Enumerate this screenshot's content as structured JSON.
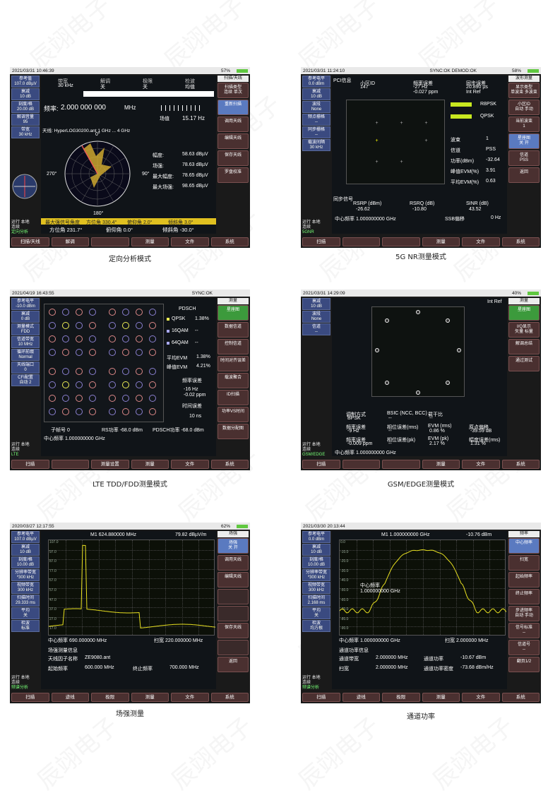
{
  "watermark": "辰翊电子",
  "panels": {
    "p1": {
      "caption": "定向分析模式",
      "datetime": "2021/03/31  10:46:39",
      "battery": "57%",
      "left": [
        {
          "l": "参考值",
          "v": "107.0 dBµV"
        },
        {
          "l": "衰减",
          "v": "10 dB"
        },
        {
          "l": "刻度/格",
          "v": "20.00 dB"
        },
        {
          "l": "解调音量",
          "v": "95"
        },
        {
          "l": "带宽",
          "v": "30 kHz"
        }
      ],
      "right_title": "扫描/天线",
      "right": [
        "扫描类型\n连续  单次",
        "重新扫描",
        "调用天线",
        "编辑天线",
        "保存天线",
        "罗盘校准"
      ],
      "bottom": [
        "扫描/天线",
        "解调",
        "",
        "测量",
        "文件",
        "系统"
      ],
      "headers": [
        "带宽",
        "解调",
        "极限",
        "检波"
      ],
      "header_vals": [
        "30 kHz",
        "关",
        "关",
        "均值"
      ],
      "freq_label": "频率:",
      "freq": "2.000 000 000",
      "freq_unit": "MHz",
      "signal_label": "场值",
      "signal": "15.17 Hz",
      "antenna": "天线: HyperLOG30200.ant  1 GHz ... 4 GHz",
      "deg0": "0°",
      "deg90": "90°",
      "deg180": "180°",
      "deg270": "270°",
      "meas": [
        [
          "幅度:",
          "58.63 dBµV"
        ],
        [
          "场强:",
          "78.63 dBµV"
        ],
        [
          "最大幅度:",
          "78.65 dBµV"
        ],
        [
          "最大场强:",
          "98.65 dBµV"
        ]
      ],
      "yellow": [
        "最大强信号角度",
        "方位角  330.4°",
        "俯仰角  2.0°",
        "倾斜角  3.0°"
      ],
      "azimuth": [
        "方位角  231.7°",
        "俯仰角  0.0°",
        "倾斜角  -30.0°"
      ],
      "status": [
        "运行  本地",
        "连续",
        "定向分析"
      ]
    },
    "p2": {
      "caption": "5G NR测量模式",
      "datetime": "2021/03/31  11:24:10",
      "battery": "58%",
      "sync": "SYNC:OK   DEMOD:OK",
      "left": [
        {
          "l": "参考电平",
          "v": "0.0 dBm"
        },
        {
          "l": "衰减",
          "v": "10 dB"
        },
        {
          "l": "波段",
          "v": "None"
        },
        {
          "l": "频点栅格",
          "v": "--"
        },
        {
          "l": "同步栅格",
          "v": "--"
        },
        {
          "l": "载波间隔",
          "v": "30 kHz"
        }
      ],
      "right_title": "波形测量",
      "right": [
        "显示类型\n单波束 多波束",
        "小区ID\n自动  手动",
        "当前波束\n1",
        "星座图\n关   开",
        "信道\nPSS",
        "返回"
      ],
      "bottom": [
        "扫描",
        "",
        "",
        "测量",
        "文件",
        "系统"
      ],
      "pci_label": "PCI信息",
      "pci_cols": [
        [
          "小区ID",
          "147"
        ],
        [
          "频率误差",
          "-27 Hz",
          "-0.027 ppm"
        ],
        [
          "同步误差",
          "20.890 µs",
          "Int Ref"
        ]
      ],
      "legend": [
        [
          "R8PSK",
          ""
        ],
        [
          "QPSK",
          ""
        ]
      ],
      "info": [
        [
          "波束",
          "1"
        ],
        [
          "信道",
          "PSS"
        ],
        [
          "功率(dBm)",
          "-32.64"
        ],
        [
          "峰值EVM(%)",
          "3.91"
        ],
        [
          "平均EVM(%)",
          "0.63"
        ]
      ],
      "sync_label": "同步信号",
      "rsrp": [
        [
          "RSRP (dBm)",
          "-26.62"
        ],
        [
          "RSRQ (dB)",
          "-10.80"
        ],
        [
          "SINR (dB)",
          "43.52"
        ]
      ],
      "center": "中心频率     1.000000000 GHz",
      "ssb": "SSB偏移",
      "ssb_v": "0 Hz",
      "status": [
        "运行  本地",
        "连续",
        "5GNR"
      ]
    },
    "p3": {
      "caption": "LTE TDD/FDD测量模式",
      "datetime": "2021/04/19  16:43:55",
      "sync": "SYNC:OK",
      "left": [
        {
          "l": "参考电平",
          "v": "-10.0 dBm"
        },
        {
          "l": "衰减",
          "v": "0 dB"
        },
        {
          "l": "测量模式",
          "v": "FDD"
        },
        {
          "l": "信道带宽",
          "v": "10 MHz"
        },
        {
          "l": "循环前缀",
          "v": "Normal"
        },
        {
          "l": "天线端口",
          "v": "0"
        },
        {
          "l": "CFI配置",
          "v": "自动 2"
        }
      ],
      "right_title": "测量",
      "right": [
        "星座图",
        "数据信道",
        "控制信道",
        "时间对齐误差",
        "载波聚合",
        "ID扫描",
        "功率VS时间",
        "数据分配图"
      ],
      "bottom": [
        "扫描",
        "",
        "测量设置",
        "测量",
        "文件",
        "系统"
      ],
      "pdsch": "PDSCH",
      "mods": [
        [
          "QPSK",
          "1.38%"
        ],
        [
          "16QAM",
          "--"
        ],
        [
          "64QAM",
          "--"
        ]
      ],
      "evm": [
        [
          "平均EVM",
          "1.38%"
        ],
        [
          "峰值EVM",
          "4.21%"
        ]
      ],
      "freq_err_label": "频率误差",
      "freq_err": [
        "-16 Hz",
        "-0.02 ppm"
      ],
      "time_err_label": "时间误差",
      "time_err": "10 ns",
      "foot": [
        "子帧号  0",
        "RS功率  -68.0 dBm",
        "PDSCH功率  -68.0 dBm"
      ],
      "center": "中心频率     1.000000000 GHz",
      "status": [
        "运行  本地",
        "连续",
        "LTE"
      ]
    },
    "p4": {
      "caption": "GSM/EDGE测量模式",
      "datetime": "2021/03/31  14:29:09",
      "battery": "40%",
      "intref": "Int Ref",
      "left": [
        {
          "l": "衰减",
          "v": "10 dB"
        },
        {
          "l": "波段",
          "v": "None"
        },
        {
          "l": "信道",
          "v": "--"
        }
      ],
      "right_title": "测量",
      "right": [
        "星座图",
        "I/Q显示\n矢量  标量",
        "解调总结",
        "通过测试"
      ],
      "bottom": [
        "扫描",
        "",
        "",
        "测量",
        "文件",
        "系统"
      ],
      "table": [
        [
          "调制方式",
          "BPSK"
        ],
        [
          "BSIC (NCC, BCC)",
          "--"
        ],
        [
          "载干比",
          "--"
        ]
      ],
      "table2": [
        [
          "频率误差",
          "-9 Hz"
        ],
        [
          "相位误差(rms)",
          "--"
        ],
        [
          "EVM (rms)",
          "0.86 %"
        ],
        [
          "原点偏移",
          "-39.59 dB"
        ]
      ],
      "table3": [
        [
          "频率误差",
          "-0.009 ppm"
        ],
        [
          "相位误差(pk)",
          "--"
        ],
        [
          "EVM (pk)",
          "2.17 %"
        ],
        [
          "幅度误差(rms)",
          "1.31 %"
        ]
      ],
      "center": "中心频率     1.000000000 GHz",
      "status": [
        "运行  本地",
        "连续",
        "GSM/EDGE"
      ]
    },
    "p5": {
      "caption": "场强测量",
      "datetime": "2020/03/27  12:17:55",
      "battery": "62%",
      "marker": "M1    624.880000 MHz",
      "marker_v": "79.82 dBµV/m",
      "left": [
        {
          "l": "参考电平",
          "v": "107.0 dBµV"
        },
        {
          "l": "衰减",
          "v": "10 dB"
        },
        {
          "l": "刻度/格",
          "v": "10.00 dB"
        },
        {
          "l": "分辨率带宽",
          "v": "*300 kHz"
        },
        {
          "l": "视频带宽",
          "v": "300 kHz"
        },
        {
          "l": "扫描时间",
          "v": "29.333 ms"
        },
        {
          "l": "平均",
          "v": "关"
        },
        {
          "l": "检波",
          "v": "标准"
        }
      ],
      "right_title": "场强",
      "right": [
        "场强\n关   开",
        "调用天线",
        "编辑天线",
        "",
        "",
        "保存天线",
        "",
        "返回"
      ],
      "bottom": [
        "扫描",
        "迹线",
        "极限",
        "测量",
        "文件",
        "系统"
      ],
      "yticks": [
        "107.0",
        "97.0",
        "87.0",
        "77.0",
        "67.0",
        "57.0",
        "47.0",
        "37.0",
        "27.0",
        "17.0"
      ],
      "center": "中心频率   690.000000 MHz",
      "span": "扫宽    220.000000 MHz",
      "info_title": "场强测量信息",
      "info": [
        [
          "天线因子名称",
          "ZE9080.ant"
        ],
        [
          "起始频率",
          "600.000 MHz"
        ],
        [
          "终止频率",
          "700.000 MHz"
        ]
      ],
      "status": [
        "运行  本地",
        "连续",
        "频谱分析"
      ]
    },
    "p6": {
      "caption": "通道功率",
      "datetime": "2021/03/30  20:13:44",
      "marker": "M1    1.000000000 GHz",
      "marker_v": "-10.76 dBm",
      "left": [
        {
          "l": "参考电平",
          "v": "0.0 dBm"
        },
        {
          "l": "衰减",
          "v": "10 dB"
        },
        {
          "l": "刻度/格",
          "v": "10.00 dB"
        },
        {
          "l": "分辨率带宽",
          "v": "*300 kHz"
        },
        {
          "l": "视频带宽",
          "v": "300 kHz"
        },
        {
          "l": "扫描时间",
          "v": "2.168 ms"
        },
        {
          "l": "平均",
          "v": "关"
        },
        {
          "l": "检波",
          "v": "均方根"
        }
      ],
      "right_title": "频率",
      "right": [
        "中心频率",
        "扫宽",
        "起始频率",
        "终止频率",
        "步进频率\n自动  手动",
        "信号标准\n--",
        "信道号\n--",
        "翻页1/2"
      ],
      "bottom": [
        "扫描",
        "迹线",
        "极限",
        "测量",
        "文件",
        "系统"
      ],
      "yticks": [
        "0.0",
        "-10.0",
        "-20.0",
        "-30.0",
        "-40.0",
        "-50.0",
        "-60.0",
        "-70.0",
        "-80.0",
        "-90.0"
      ],
      "center_in": "中心频率",
      "center_in_v": "1.000000000 GHz",
      "center": "中心频率  1.000000000 GHz",
      "span": "扫宽     2.000000 MHz",
      "info_title": "通道功率信息",
      "info": [
        [
          "通道带宽",
          "2.000000 MHz"
        ],
        [
          "通道功率",
          "-10.67 dBm"
        ],
        [
          "扫宽",
          "2.000000 MHz"
        ],
        [
          "通道功率密度",
          "-73.68 dBm/Hz"
        ]
      ],
      "status": [
        "运行  本地",
        "连续",
        "频谱分析"
      ]
    }
  }
}
